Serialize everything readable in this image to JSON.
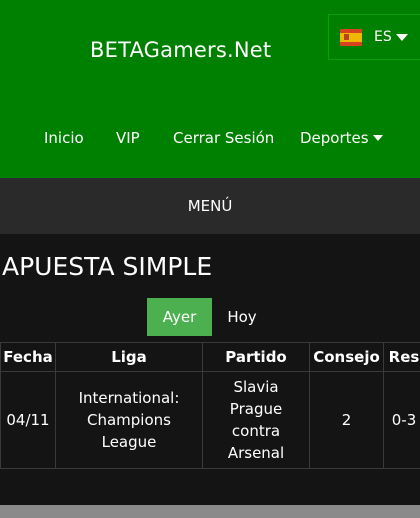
{
  "header": {
    "site_title": "BETAGamers.Net",
    "language": {
      "code": "ES",
      "flag": "spain-flag"
    }
  },
  "nav": {
    "items": [
      {
        "label": "Inicio"
      },
      {
        "label": "VIP"
      },
      {
        "label": "Cerrar Sesión"
      },
      {
        "label": "Deportes"
      }
    ]
  },
  "menu": {
    "label": "MENÚ"
  },
  "main": {
    "title": "APUESTA SIMPLE",
    "tabs": [
      {
        "label": "Ayer",
        "active": true
      },
      {
        "label": "Hoy",
        "active": false
      }
    ],
    "table": {
      "headers": [
        "Fecha",
        "Liga",
        "Partido",
        "Consejo",
        "Res"
      ],
      "rows": [
        [
          "04/11",
          "International: Champions League",
          "Slavia Prague contra Arsenal",
          "2",
          "0-3"
        ]
      ]
    }
  },
  "colors": {
    "header_bg": "#008000",
    "menu_bg": "#2a2a2a",
    "page_bg": "#141414",
    "active_tab": "#4caf50"
  }
}
